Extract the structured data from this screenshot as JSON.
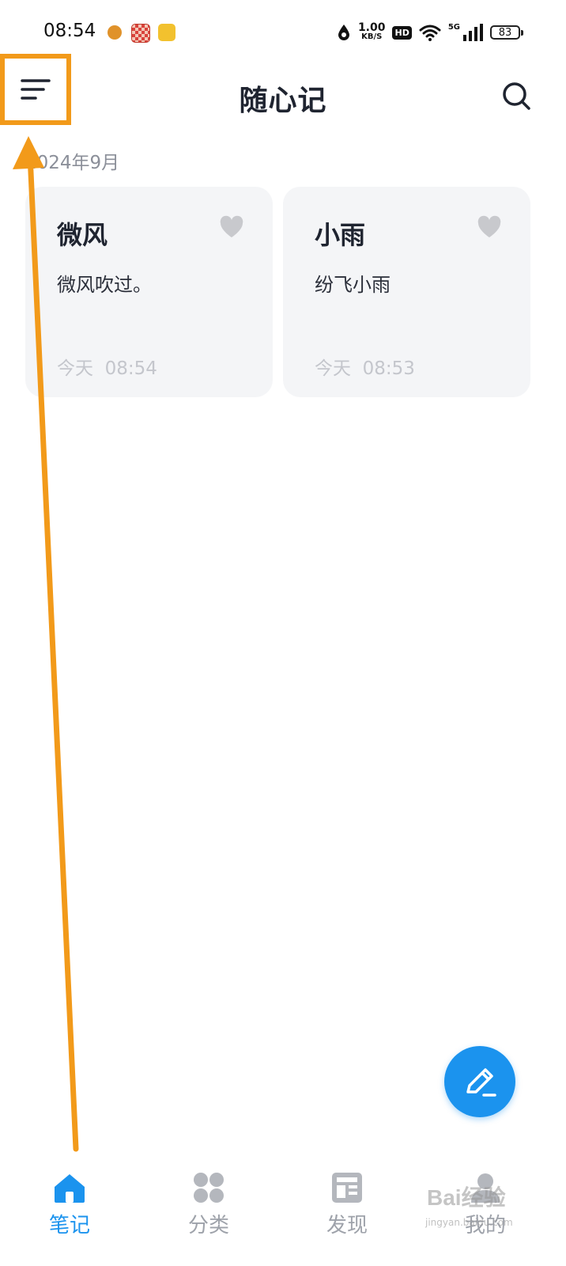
{
  "status_bar": {
    "time": "08:54",
    "net_speed_value": "1.00",
    "net_speed_unit": "KB/S",
    "hd": "HD",
    "signal_type": "5G",
    "battery": "83"
  },
  "header": {
    "title": "随心记",
    "menu_icon": "menu-icon",
    "search_icon": "search-icon"
  },
  "month_label": "2024年9月",
  "notes": [
    {
      "title": "微风",
      "body": "微风吹过。",
      "time": "今天  08:54"
    },
    {
      "title": "小雨",
      "body": "纷飞小雨",
      "time": "今天  08:53"
    }
  ],
  "bottom_nav": [
    {
      "label": "笔记",
      "icon": "home-icon",
      "active": true
    },
    {
      "label": "分类",
      "icon": "category-icon",
      "active": false
    },
    {
      "label": "发现",
      "icon": "discover-icon",
      "active": false
    },
    {
      "label": "我的",
      "icon": "profile-icon",
      "active": false
    }
  ],
  "colors": {
    "accent": "#1b93ee",
    "annotation": "#f29a1a",
    "card_bg": "#f4f5f7"
  },
  "watermark": {
    "text": "Bai经验",
    "sub": "jingyan.baidu.com"
  }
}
